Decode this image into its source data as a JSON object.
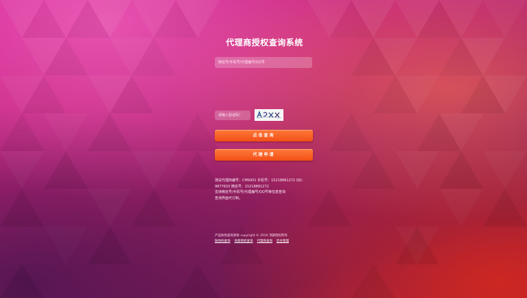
{
  "app": {
    "title": "代理商授权查询系统"
  },
  "form": {
    "id_placeholder": "微信号/手机号/代理编号/QQ号",
    "captcha_placeholder": "请输入验证码！",
    "captcha_text": "A 6 X X"
  },
  "buttons": {
    "query_label": "点击查询",
    "apply_label": "代理申请"
  },
  "test_info": {
    "line1": "测试代理商编号：CMS001 手机号：15218861272 QQ：",
    "line2": "9877633 微信号：15218861272",
    "line3": "支持微信号/手机号/代理编号/QQ号等任意查询",
    "line4": "查询界面可订制。"
  },
  "footer": {
    "copyright": "产品防伪查询系统 copyright © 2016 顶部授权所有",
    "links": [
      "防伪码查询",
      "商家授权查询",
      "代理商查询",
      "后台管理"
    ]
  },
  "colors": {
    "button": "#f24f16",
    "bg_primary": "#c2257d"
  }
}
